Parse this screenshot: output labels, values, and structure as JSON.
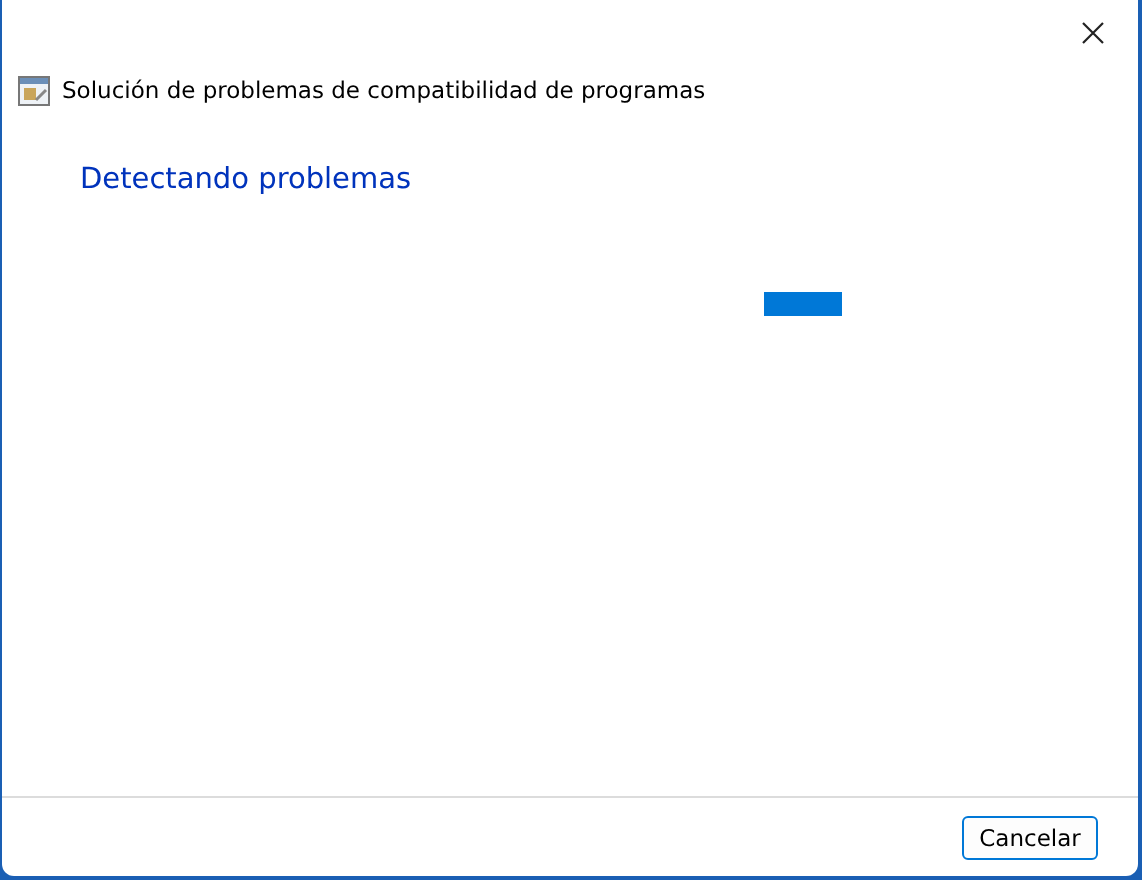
{
  "window": {
    "title": "Solución de problemas de compatibilidad de programas"
  },
  "heading": "Detectando problemas",
  "progress": {
    "kind": "marquee"
  },
  "buttons": [
    {
      "label": "Cancelar",
      "focused": true
    }
  ]
}
